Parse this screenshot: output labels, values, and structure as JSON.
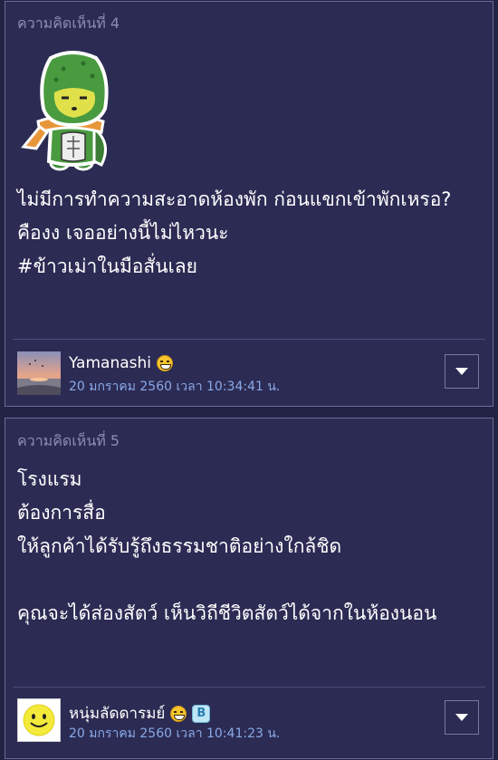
{
  "comments": [
    {
      "header": "ความคิดเห็นที่ 4",
      "body": [
        "ไม่มีการทำความสะอาดห้องพัก ก่อนแขกเข้าพักเหรอ?",
        "คืองง เจออย่างนี้ไม่ไหวนะ",
        "#ข้าวเม่าในมือสั่นเลย"
      ],
      "username": "Yamanashi",
      "timestamp": "20 มกราคม 2560 เวลา 10:34:41 น.",
      "avatar_icon": "sunset-beach-avatar-icon",
      "user_badges": [
        "laughing-emoji-icon"
      ]
    },
    {
      "header": "ความคิดเห็นที่ 5",
      "body": [
        "โรงแรม",
        "ต้องการสื่อ",
        "ให้ลูกค้าได้รับรู้ถึงธรรมชาติอย่างใกล้ชิด",
        "",
        "คุณจะได้ส่องสัตว์ เห็นวิถีชีวิตสัตว์ได้จากในห้องนอน"
      ],
      "username": "หนุ่มลัดดารมย์",
      "timestamp": "20 มกราคม 2560 เวลา 10:41:23 น.",
      "avatar_icon": "smiley-face-avatar-icon",
      "user_badges": [
        "laughing-emoji-icon",
        "blog-b-badge-icon"
      ],
      "blog_badge_letter": "B"
    }
  ],
  "colors": {
    "page_background": "#232345",
    "card_background": "#2c2b54",
    "card_border": "#6d6b95",
    "header_text": "#8f8db2",
    "timestamp_text": "#8aa9e6"
  }
}
